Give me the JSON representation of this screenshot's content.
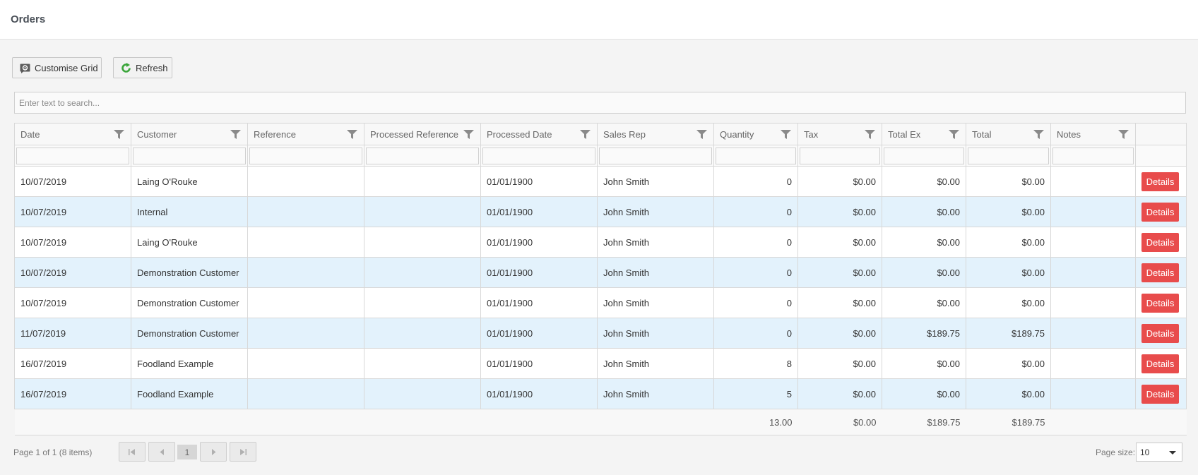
{
  "page": {
    "title": "Orders"
  },
  "toolbar": {
    "customise_label": "Customise Grid",
    "refresh_label": "Refresh"
  },
  "search": {
    "placeholder": "Enter text to search..."
  },
  "columns": [
    "Date",
    "Customer",
    "Reference",
    "Processed Reference",
    "Processed Date",
    "Sales Rep",
    "Quantity",
    "Tax",
    "Total Ex",
    "Total",
    "Notes"
  ],
  "rows": [
    {
      "date": "10/07/2019",
      "customer": "Laing O'Rouke",
      "reference": "",
      "processed_reference": "",
      "processed_date": "01/01/1900",
      "sales_rep": "John Smith",
      "quantity": "0",
      "tax": "$0.00",
      "total_ex": "$0.00",
      "total": "$0.00",
      "notes": ""
    },
    {
      "date": "10/07/2019",
      "customer": "Internal",
      "reference": "",
      "processed_reference": "",
      "processed_date": "01/01/1900",
      "sales_rep": "John Smith",
      "quantity": "0",
      "tax": "$0.00",
      "total_ex": "$0.00",
      "total": "$0.00",
      "notes": ""
    },
    {
      "date": "10/07/2019",
      "customer": "Laing O'Rouke",
      "reference": "",
      "processed_reference": "",
      "processed_date": "01/01/1900",
      "sales_rep": "John Smith",
      "quantity": "0",
      "tax": "$0.00",
      "total_ex": "$0.00",
      "total": "$0.00",
      "notes": ""
    },
    {
      "date": "10/07/2019",
      "customer": "Demonstration Customer",
      "reference": "",
      "processed_reference": "",
      "processed_date": "01/01/1900",
      "sales_rep": "John Smith",
      "quantity": "0",
      "tax": "$0.00",
      "total_ex": "$0.00",
      "total": "$0.00",
      "notes": ""
    },
    {
      "date": "10/07/2019",
      "customer": "Demonstration Customer",
      "reference": "",
      "processed_reference": "",
      "processed_date": "01/01/1900",
      "sales_rep": "John Smith",
      "quantity": "0",
      "tax": "$0.00",
      "total_ex": "$0.00",
      "total": "$0.00",
      "notes": ""
    },
    {
      "date": "11/07/2019",
      "customer": "Demonstration Customer",
      "reference": "",
      "processed_reference": "",
      "processed_date": "01/01/1900",
      "sales_rep": "John Smith",
      "quantity": "0",
      "tax": "$0.00",
      "total_ex": "$189.75",
      "total": "$189.75",
      "notes": ""
    },
    {
      "date": "16/07/2019",
      "customer": "Foodland Example",
      "reference": "",
      "processed_reference": "",
      "processed_date": "01/01/1900",
      "sales_rep": "John Smith",
      "quantity": "8",
      "tax": "$0.00",
      "total_ex": "$0.00",
      "total": "$0.00",
      "notes": ""
    },
    {
      "date": "16/07/2019",
      "customer": "Foodland Example",
      "reference": "",
      "processed_reference": "",
      "processed_date": "01/01/1900",
      "sales_rep": "John Smith",
      "quantity": "5",
      "tax": "$0.00",
      "total_ex": "$0.00",
      "total": "$0.00",
      "notes": ""
    }
  ],
  "details_label": "Details",
  "footer": {
    "quantity": "13.00",
    "tax": "$0.00",
    "total_ex": "$189.75",
    "total": "$189.75"
  },
  "pager": {
    "info": "Page 1 of 1 (8 items)",
    "current_page": "1",
    "page_size_label": "Page size:",
    "page_size": "10"
  },
  "colors": {
    "accent": "#e84c4c",
    "alt_row": "#e3f2fc",
    "refresh_icon": "#3aa53a"
  },
  "icons": {
    "customise": "settings-icon",
    "refresh": "refresh-icon",
    "filter": "filter-funnel-icon"
  }
}
